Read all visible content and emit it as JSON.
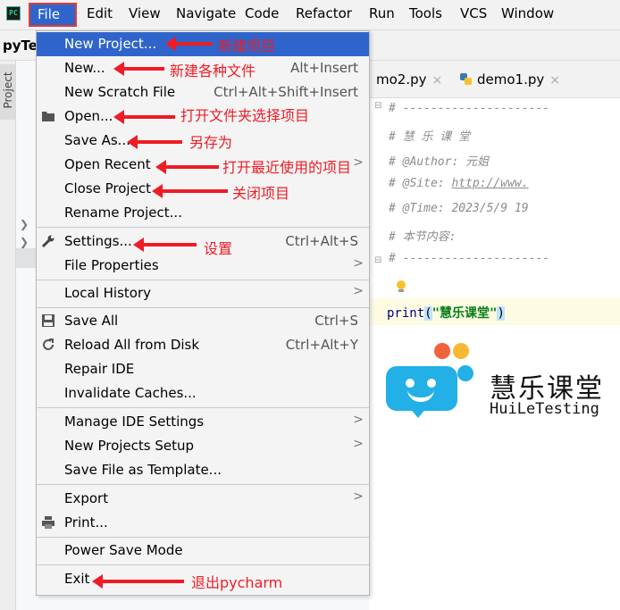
{
  "menubar": {
    "items": [
      "File",
      "Edit",
      "View",
      "Navigate",
      "Code",
      "Refactor",
      "Run",
      "Tools",
      "VCS",
      "Window"
    ]
  },
  "titlebar": {
    "project_name": "pyTe"
  },
  "toolwindow": {
    "project_tab": "Project"
  },
  "editor": {
    "tabs": [
      {
        "label": "mo2.py",
        "close": "×"
      },
      {
        "label": "demo1.py",
        "close": "×"
      }
    ],
    "lines": [
      "# ---------------------",
      "# 慧 乐 课 堂",
      "# @Author: 元姐",
      "# @Site: ",
      "http://www.",
      "# @Time: 2023/5/9 19",
      "# 本节内容:",
      "# ---------------------"
    ],
    "print_fn": "print",
    "print_open": "(",
    "print_arg": "\"慧乐课堂\"",
    "print_close": ")"
  },
  "watermark": {
    "cn": "慧乐课堂",
    "en": "HuiLeTesting"
  },
  "menu": {
    "items": [
      {
        "label": "New Project...",
        "shortcut": ""
      },
      {
        "label": "New...",
        "shortcut": "Alt+Insert"
      },
      {
        "label": "New Scratch File",
        "shortcut": "Ctrl+Alt+Shift+Insert"
      },
      {
        "label": "Open...",
        "shortcut": ""
      },
      {
        "label": "Save As...",
        "shortcut": ""
      },
      {
        "label": "Open Recent",
        "shortcut": ""
      },
      {
        "label": "Close Project",
        "shortcut": ""
      },
      {
        "label": "Rename Project...",
        "shortcut": ""
      },
      {
        "label": "Settings...",
        "shortcut": "Ctrl+Alt+S"
      },
      {
        "label": "File Properties",
        "shortcut": ""
      },
      {
        "label": "Local History",
        "shortcut": ""
      },
      {
        "label": "Save All",
        "shortcut": "Ctrl+S"
      },
      {
        "label": "Reload All from Disk",
        "shortcut": "Ctrl+Alt+Y"
      },
      {
        "label": "Repair IDE",
        "shortcut": ""
      },
      {
        "label": "Invalidate Caches...",
        "shortcut": ""
      },
      {
        "label": "Manage IDE Settings",
        "shortcut": ""
      },
      {
        "label": "New Projects Setup",
        "shortcut": ""
      },
      {
        "label": "Save File as Template...",
        "shortcut": ""
      },
      {
        "label": "Export",
        "shortcut": ""
      },
      {
        "label": "Print...",
        "shortcut": ""
      },
      {
        "label": "Power Save Mode",
        "shortcut": ""
      },
      {
        "label": "Exit",
        "shortcut": ""
      }
    ],
    "submenu_glyph": ">"
  },
  "annotations": {
    "new_project": "新建项目",
    "new": "新建各种文件",
    "open": "打开文件夹选择项目",
    "save_as": "另存为",
    "open_recent": "打开最近使用的项目",
    "close_project": "关闭项目",
    "settings": "设置",
    "exit": "退出pycharm"
  },
  "colors": {
    "accent": "#2f65ca",
    "annotation": "#ee1c25"
  }
}
